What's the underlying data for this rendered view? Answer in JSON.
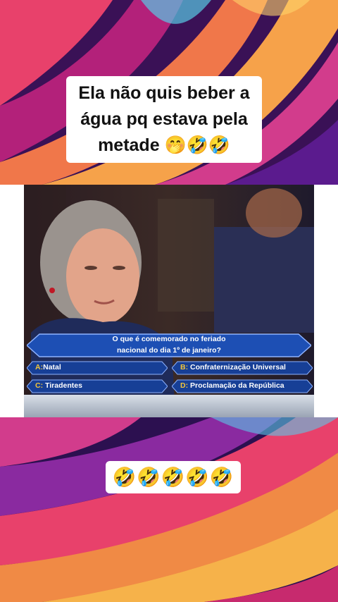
{
  "caption_top": {
    "line1": "Ela não quis beber a",
    "line2": "água pq estava pela",
    "line3": "metade 🤭🤣🤣"
  },
  "caption_bottom": "🤣🤣🤣🤣🤣",
  "quiz": {
    "question_line1": "O que é comemorado no feriado",
    "question_line2": "nacional do dia 1º de janeiro?",
    "answers": [
      {
        "letter": "A:",
        "text": "Natal"
      },
      {
        "letter": "B:",
        "text": "Confraternização Universal"
      },
      {
        "letter": "C:",
        "text": "Tiradentes"
      },
      {
        "letter": "D:",
        "text": "Proclamação da República"
      }
    ]
  },
  "colors": {
    "answer_letter": "#f3c63a",
    "panel_blue": "#1d4fb4",
    "panel_border": "#8fb3ff"
  }
}
